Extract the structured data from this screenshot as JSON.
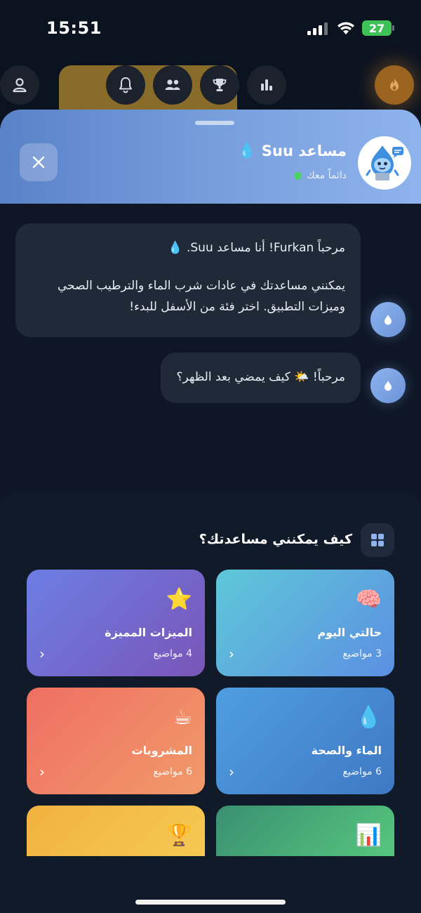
{
  "status": {
    "time": "15:51",
    "battery": "27"
  },
  "top_icons": [
    "profile-icon",
    "card-add-icon",
    "bell-icon",
    "people-icon",
    "trophy-icon",
    "chart-icon",
    "fire-icon"
  ],
  "header": {
    "title": "مساعد Suu",
    "title_emoji": "💧",
    "subtitle": "دائماً معك"
  },
  "messages": [
    {
      "line1": "مرحباً Furkan! أنا مساعد Suu. 💧",
      "line2": "يمكنني مساعدتك في عادات شرب الماء والترطيب الصحي وميزات التطبيق. اختر فئة من الأسفل للبدء!"
    },
    {
      "line1": "مرحباً! 🌤️ كيف يمضي بعد الظهر؟"
    }
  ],
  "help": {
    "title": "كيف يمكنني مساعدتك؟",
    "cards": [
      {
        "emoji": "🧠",
        "title": "حالتي اليوم",
        "count": "3 مواضيع"
      },
      {
        "emoji": "⭐",
        "title": "الميزات المميزة",
        "count": "4 مواضيع"
      },
      {
        "emoji": "💧",
        "title": "الماء والصحة",
        "count": "6 مواضيع"
      },
      {
        "emoji": "☕",
        "title": "المشروبات",
        "count": "6 مواضيع"
      },
      {
        "emoji": "📊",
        "title": "",
        "count": ""
      },
      {
        "emoji": "🏆",
        "title": "",
        "count": ""
      }
    ]
  },
  "colors": {
    "background": "#0c1320",
    "header_gradient_start": "#5a82c8",
    "header_gradient_end": "#8fb3ec",
    "bubble": "#1f2938",
    "online": "#4cd263"
  }
}
